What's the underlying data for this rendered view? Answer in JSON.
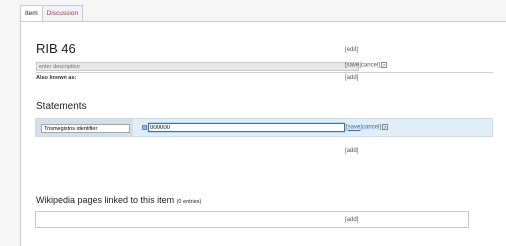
{
  "tabs": {
    "item": "Item",
    "discussion": "Discussion"
  },
  "item": {
    "label": "RIB 46",
    "edit": "[edit]",
    "description_placeholder": "enter description",
    "desc_actions": {
      "open": "[",
      "save": "save",
      "sep": "|",
      "cancel": "cancel",
      "close": "]",
      "help": "?"
    },
    "aliases_label": "Also known as:",
    "aliases_add": "[add]"
  },
  "statements": {
    "heading": "Statements",
    "property": "Trismegistos identifier",
    "value": "000000",
    "actions": {
      "open": "[",
      "save": "save",
      "sep": "|",
      "cancel": "cancel",
      "close": "]",
      "help": "?"
    },
    "add": "[add]"
  },
  "sitelinks": {
    "heading": "Wikipedia pages linked to this item",
    "count": "(0 entries)",
    "add": "[add]"
  },
  "colors": {
    "accent": "#3366cc",
    "statement_bg": "#dfeef7",
    "tab_link": "#b0392b"
  }
}
